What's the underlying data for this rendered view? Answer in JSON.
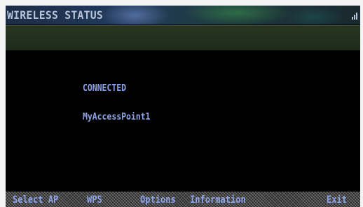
{
  "header": {
    "title": "WIRELESS STATUS",
    "signal_icon": "signal-strength-icon"
  },
  "status": {
    "connection_state": "CONNECTED",
    "access_point_name": "MyAccessPoint1"
  },
  "footer": {
    "buttons": [
      {
        "label": "Select AP"
      },
      {
        "label": "WPS"
      },
      {
        "label": "Options"
      },
      {
        "label": "Information"
      },
      {
        "label": "Exit"
      }
    ]
  },
  "colors": {
    "text_accent": "#8fa4e6",
    "title_text": "#b6c3d8",
    "background": "#000000"
  }
}
